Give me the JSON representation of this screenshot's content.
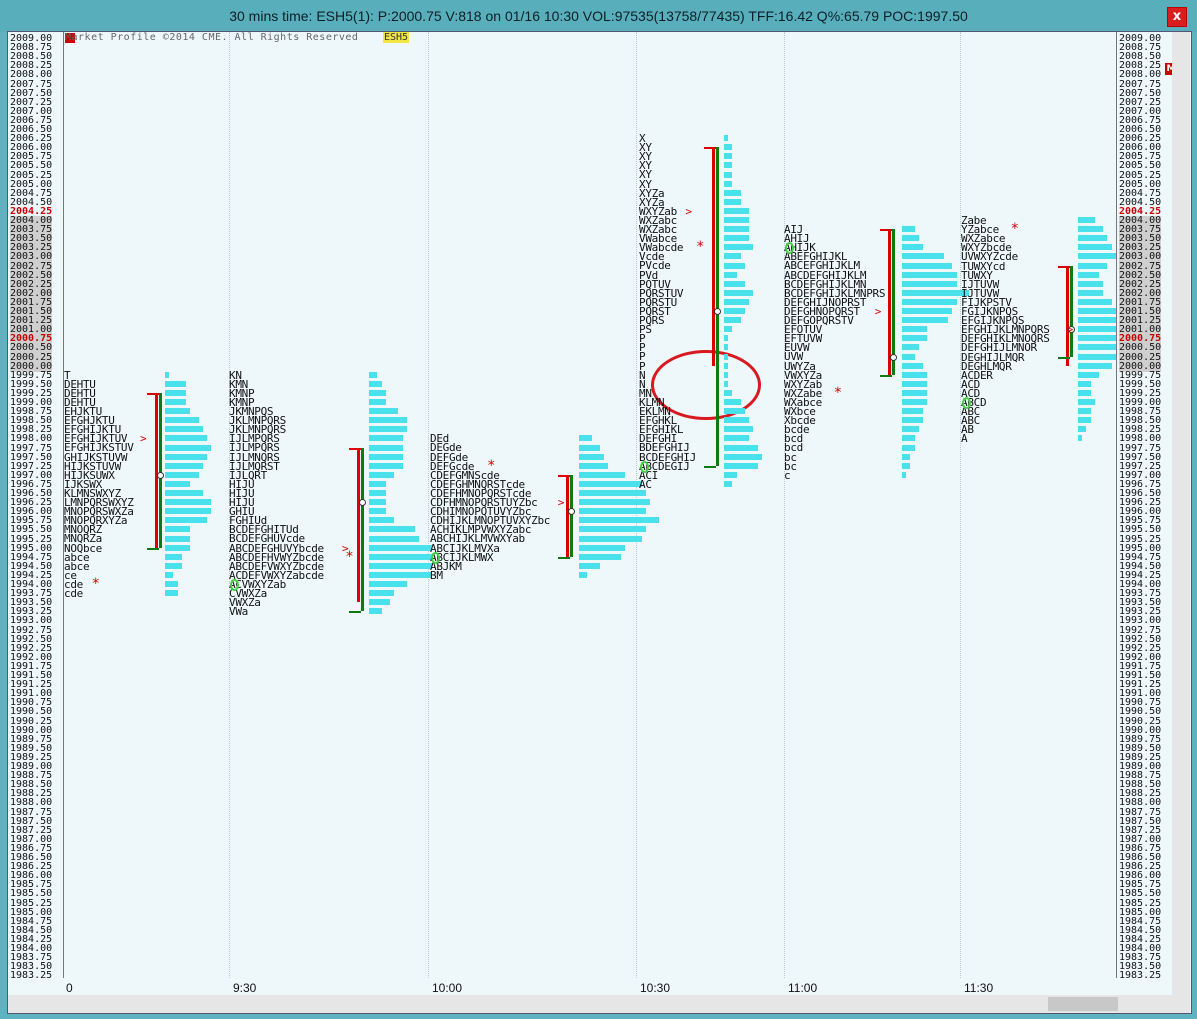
{
  "window": {
    "title": "30 mins time: ESH5(1): P:2000.75 V:818 on 01/16 10:30 VOL:97535(13758/77435) TFF:16.42 Q%:65.79 POC:1997.50",
    "close_label": "x"
  },
  "chart": {
    "copyright": "Market Profile ©2014 CME. All Rights Reserved",
    "symbol": "ESH5",
    "right_marker": "M",
    "current_price": "2000.75",
    "highlight_price": "2004.25",
    "time_labels": [
      "0",
      "9:30",
      "10:00",
      "10:30",
      "11:00",
      "11:30"
    ]
  },
  "price_scale": {
    "start": 2009.0,
    "step": 0.25,
    "count": 104
  },
  "profiles": [
    {
      "rows": [
        {
          "p": "1999.75",
          "t": "T"
        },
        {
          "p": "1999.50",
          "t": "DEHTU"
        },
        {
          "p": "1999.25",
          "t": "DEHTU"
        },
        {
          "p": "1999.00",
          "t": "DEHTU"
        },
        {
          "p": "1998.75",
          "t": "EHJKTU"
        },
        {
          "p": "1998.50",
          "t": "EFGHJKTU"
        },
        {
          "p": "1998.25",
          "t": "EFGHIJKTU"
        },
        {
          "p": "1998.00",
          "t": "EFGHIJKTUV"
        },
        {
          "p": "1997.75",
          "t": "EFGHIJKSTUV"
        },
        {
          "p": "1997.50",
          "t": "GHIJKSTUVW"
        },
        {
          "p": "1997.25",
          "t": "HIJKSTUVW"
        },
        {
          "p": "1997.00",
          "t": "HIJKSUWX"
        },
        {
          "p": "1996.75",
          "t": "IJKSWX"
        },
        {
          "p": "1996.50",
          "t": "KLMNSWXYZ"
        },
        {
          "p": "1996.25",
          "t": "LMNPQRSWXYZ"
        },
        {
          "p": "1996.00",
          "t": "MNOPQRSWXZa"
        },
        {
          "p": "1995.75",
          "t": "MNOPQRXYZa"
        },
        {
          "p": "1995.50",
          "t": "MNOQRZ"
        },
        {
          "p": "1995.25",
          "t": "MNQRZa"
        },
        {
          "p": "1995.00",
          "t": "NOQbce"
        },
        {
          "p": "1994.75",
          "t": "abce"
        },
        {
          "p": "1994.50",
          "t": "abce"
        },
        {
          "p": "1994.25",
          "t": "ce"
        },
        {
          "p": "1994.00",
          "t": "cde"
        },
        {
          "p": "1993.75",
          "t": "cde"
        }
      ]
    },
    {
      "rows": [
        {
          "p": "1999.75",
          "t": "KN"
        },
        {
          "p": "1999.50",
          "t": "KMN"
        },
        {
          "p": "1999.25",
          "t": "KMNP"
        },
        {
          "p": "1999.00",
          "t": "KMNP"
        },
        {
          "p": "1998.75",
          "t": "JKMNPQS"
        },
        {
          "p": "1998.50",
          "t": "JKLMNPQRS"
        },
        {
          "p": "1998.25",
          "t": "JKLMNPQRS"
        },
        {
          "p": "1998.00",
          "t": "IJLMPQRS"
        },
        {
          "p": "1997.75",
          "t": "IJLMPQRS"
        },
        {
          "p": "1997.50",
          "t": "IJLMNQRS"
        },
        {
          "p": "1997.25",
          "t": "IJLMQRST"
        },
        {
          "p": "1997.00",
          "t": "IJLQRT"
        },
        {
          "p": "1996.75",
          "t": "HIJU"
        },
        {
          "p": "1996.50",
          "t": "HIJU"
        },
        {
          "p": "1996.25",
          "t": "HIJU"
        },
        {
          "p": "1996.00",
          "t": "GHIU"
        },
        {
          "p": "1995.75",
          "t": "FGHIUd"
        },
        {
          "p": "1995.50",
          "t": "BCDEFGHITUd"
        },
        {
          "p": "1995.25",
          "t": "BCDEFGHUVcde"
        },
        {
          "p": "1995.00",
          "t": "ABCDEFGHUVYbcde"
        },
        {
          "p": "1994.75",
          "t": "ABCDEFHVWYZbcde"
        },
        {
          "p": "1994.50",
          "t": "ABCDEFVWXYZbcde"
        },
        {
          "p": "1994.25",
          "t": "ACDEFVWXYZabcde"
        },
        {
          "p": "1994.00",
          "t": "ACVWXYZab"
        },
        {
          "p": "1993.75",
          "t": "CVWXZa"
        },
        {
          "p": "1993.50",
          "t": "VWXZa"
        },
        {
          "p": "1993.25",
          "t": "VWa"
        }
      ]
    },
    {
      "rows": [
        {
          "p": "1998.00",
          "t": "DEd"
        },
        {
          "p": "1997.75",
          "t": "DEGde"
        },
        {
          "p": "1997.50",
          "t": "DEFGde"
        },
        {
          "p": "1997.25",
          "t": "DEFGcde"
        },
        {
          "p": "1997.00",
          "t": "CDEFGMNScde"
        },
        {
          "p": "1996.75",
          "t": "CDEFGHMNQRSTcde"
        },
        {
          "p": "1996.50",
          "t": "CDEFHMNOPQRSTcde"
        },
        {
          "p": "1996.25",
          "t": "CDFHMNOPQRSTUYZbc"
        },
        {
          "p": "1996.00",
          "t": "CDHIMNOPQTUVYZbc"
        },
        {
          "p": "1995.75",
          "t": "CDHIJKLMNOPTUVXYZbc"
        },
        {
          "p": "1995.50",
          "t": "ACHIKLMPVWXYZabc"
        },
        {
          "p": "1995.25",
          "t": "ABCHIJKLMVWXYab"
        },
        {
          "p": "1995.00",
          "t": "ABCIJKLMVXa"
        },
        {
          "p": "1994.75",
          "t": "ABCIJKLMWX"
        },
        {
          "p": "1994.50",
          "t": "ABJKM"
        },
        {
          "p": "1994.25",
          "t": "BM"
        }
      ]
    },
    {
      "rows": [
        {
          "p": "2006.25",
          "t": "X"
        },
        {
          "p": "2006.00",
          "t": "XY"
        },
        {
          "p": "2005.75",
          "t": "XY"
        },
        {
          "p": "2005.50",
          "t": "XY"
        },
        {
          "p": "2005.25",
          "t": "XY"
        },
        {
          "p": "2005.00",
          "t": "XY"
        },
        {
          "p": "2004.75",
          "t": "XYZa"
        },
        {
          "p": "2004.50",
          "t": "XYZa"
        },
        {
          "p": "2004.25",
          "t": "WXYZab"
        },
        {
          "p": "2004.00",
          "t": "WXZabc"
        },
        {
          "p": "2003.75",
          "t": "WXZabc"
        },
        {
          "p": "2003.50",
          "t": "VWabce"
        },
        {
          "p": "2003.25",
          "t": "VWabcde"
        },
        {
          "p": "2003.00",
          "t": "Vcde"
        },
        {
          "p": "2002.75",
          "t": "PVcde"
        },
        {
          "p": "2002.50",
          "t": "PVd"
        },
        {
          "p": "2002.25",
          "t": "PQTUV"
        },
        {
          "p": "2002.00",
          "t": "PQRSTUV"
        },
        {
          "p": "2001.75",
          "t": "PQRSTU"
        },
        {
          "p": "2001.50",
          "t": "PQRST"
        },
        {
          "p": "2001.25",
          "t": "PQRS"
        },
        {
          "p": "2001.00",
          "t": "PS"
        },
        {
          "p": "2000.75",
          "t": "P"
        },
        {
          "p": "2000.50",
          "t": "P"
        },
        {
          "p": "2000.25",
          "t": "P"
        },
        {
          "p": "2000.00",
          "t": "P"
        },
        {
          "p": "1999.75",
          "t": "N"
        },
        {
          "p": "1999.50",
          "t": "N"
        },
        {
          "p": "1999.25",
          "t": "MN"
        },
        {
          "p": "1999.00",
          "t": "KLMN"
        },
        {
          "p": "1998.75",
          "t": "EKLMN"
        },
        {
          "p": "1998.50",
          "t": "EFGHKL"
        },
        {
          "p": "1998.25",
          "t": "EFGHIKL"
        },
        {
          "p": "1998.00",
          "t": "DEFGHI"
        },
        {
          "p": "1997.75",
          "t": "BDEFGHIJ"
        },
        {
          "p": "1997.50",
          "t": "BCDEFGHIJ"
        },
        {
          "p": "1997.25",
          "t": "ABCDEGIJ"
        },
        {
          "p": "1997.00",
          "t": "ACI"
        },
        {
          "p": "1996.75",
          "t": "AC"
        }
      ]
    },
    {
      "rows": [
        {
          "p": "2003.75",
          "t": "AIJ"
        },
        {
          "p": "2003.50",
          "t": "AHIJ"
        },
        {
          "p": "2003.25",
          "t": "AHIJK"
        },
        {
          "p": "2003.00",
          "t": "ABEFGHIJKL"
        },
        {
          "p": "2002.75",
          "t": "ABCEFGHIJKLM"
        },
        {
          "p": "2002.50",
          "t": "ABCDEFGHIJKLM"
        },
        {
          "p": "2002.25",
          "t": "BCDEFGHIJKLMN"
        },
        {
          "p": "2002.00",
          "t": "BCDEFGHIJKLMNPRS"
        },
        {
          "p": "2001.75",
          "t": "DEFGHIJNOPRST"
        },
        {
          "p": "2001.50",
          "t": "DEFGHNOPQRST"
        },
        {
          "p": "2001.25",
          "t": "DEFGOPQRSTV"
        },
        {
          "p": "2001.00",
          "t": "EFOTUV"
        },
        {
          "p": "2000.75",
          "t": "EFTUVW"
        },
        {
          "p": "2000.50",
          "t": "EUVW"
        },
        {
          "p": "2000.25",
          "t": "UVW"
        },
        {
          "p": "2000.00",
          "t": "UWYZa"
        },
        {
          "p": "1999.75",
          "t": "VWXYZa"
        },
        {
          "p": "1999.50",
          "t": "WXYZab"
        },
        {
          "p": "1999.25",
          "t": "WXZabe"
        },
        {
          "p": "1999.00",
          "t": "WXabce"
        },
        {
          "p": "1998.75",
          "t": "WXbce"
        },
        {
          "p": "1998.50",
          "t": "Xbcde"
        },
        {
          "p": "1998.25",
          "t": "bcde"
        },
        {
          "p": "1998.00",
          "t": "bcd"
        },
        {
          "p": "1997.75",
          "t": "bcd"
        },
        {
          "p": "1997.50",
          "t": "bc"
        },
        {
          "p": "1997.25",
          "t": "bc"
        },
        {
          "p": "1997.00",
          "t": "c"
        }
      ]
    },
    {
      "rows": [
        {
          "p": "2004.00",
          "t": "Zabe"
        },
        {
          "p": "2003.75",
          "t": "YZabce"
        },
        {
          "p": "2003.50",
          "t": "WXZabce"
        },
        {
          "p": "2003.25",
          "t": "WXYZbcde"
        },
        {
          "p": "2003.00",
          "t": "UVWXYZcde"
        },
        {
          "p": "2002.75",
          "t": "TUWXYcd"
        },
        {
          "p": "2002.50",
          "t": "TUWXY"
        },
        {
          "p": "2002.25",
          "t": "IJTUVW"
        },
        {
          "p": "2002.00",
          "t": "IJTUVW"
        },
        {
          "p": "2001.75",
          "t": "FIJKPSTV"
        },
        {
          "p": "2001.50",
          "t": "FGIJKNPQS"
        },
        {
          "p": "2001.25",
          "t": "EFGIJKNPQS"
        },
        {
          "p": "2001.00",
          "t": "EFGHIJKLMNPQRS"
        },
        {
          "p": "2000.75",
          "t": "DEFGHIKLMNOQRS"
        },
        {
          "p": "2000.50",
          "t": "DEFGHIJLMNOR"
        },
        {
          "p": "2000.25",
          "t": "DEGHIJLMQR"
        },
        {
          "p": "2000.00",
          "t": "DEGHLMQR"
        },
        {
          "p": "1999.75",
          "t": "ACDER"
        },
        {
          "p": "1999.50",
          "t": "ACD"
        },
        {
          "p": "1999.25",
          "t": "ACD"
        },
        {
          "p": "1999.00",
          "t": "ABCD"
        },
        {
          "p": "1998.75",
          "t": "ABC"
        },
        {
          "p": "1998.50",
          "t": "ABC"
        },
        {
          "p": "1998.25",
          "t": "AB"
        },
        {
          "p": "1998.00",
          "t": "A"
        }
      ]
    }
  ]
}
